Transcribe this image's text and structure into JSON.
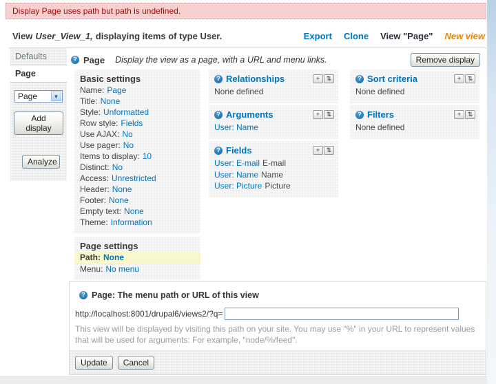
{
  "icons": {
    "question": "?",
    "add": "+",
    "rearrange": "⇅",
    "select_arrow": "▼"
  },
  "colors": {
    "link_blue": "#0074bd",
    "accent_orange": "#f08000",
    "error_red": "#a00c10",
    "error_bg": "#f8cfcf",
    "highlight_yellow": "#fbf7cd"
  },
  "error": {
    "message": "Display Page uses path but path is undefined."
  },
  "header": {
    "view_label": "View",
    "view_name": "User_View_1,",
    "view_desc": "displaying items of type User.",
    "links": {
      "export": "Export",
      "clone": "Clone",
      "view_page": "View \"Page\"",
      "new_view": "New view"
    }
  },
  "sidebar": {
    "tabs": {
      "defaults": "Defaults",
      "page": "Page"
    },
    "display_select_value": "Page",
    "add_display_label": "Add display",
    "analyze_label": "Analyze"
  },
  "display": {
    "title": "Page",
    "description": "Display the view as a page, with a URL and menu links.",
    "remove_label": "Remove display"
  },
  "basic_settings": {
    "title": "Basic settings",
    "rows": [
      {
        "label": "Name:",
        "value": "Page"
      },
      {
        "label": "Title:",
        "value": "None"
      },
      {
        "label": "Style:",
        "value": "Unformatted"
      },
      {
        "label": "Row style:",
        "value": "Fields"
      },
      {
        "label": "Use AJAX:",
        "value": "No"
      },
      {
        "label": "Use pager:",
        "value": "No"
      },
      {
        "label": "Items to display:",
        "value": "10"
      },
      {
        "label": "Distinct:",
        "value": "No"
      },
      {
        "label": "Access:",
        "value": "Unrestricted"
      },
      {
        "label": "Header:",
        "value": "None"
      },
      {
        "label": "Footer:",
        "value": "None"
      },
      {
        "label": "Empty text:",
        "value": "None"
      },
      {
        "label": "Theme:",
        "value": "Information"
      }
    ]
  },
  "page_settings": {
    "title": "Page settings",
    "path_label": "Path:",
    "path_value": "None",
    "menu_label": "Menu:",
    "menu_value": "No menu"
  },
  "panels": {
    "relationships": {
      "title": "Relationships",
      "empty": "None defined"
    },
    "arguments": {
      "title": "Arguments",
      "items": [
        {
          "link": "User: Name"
        }
      ]
    },
    "fields": {
      "title": "Fields",
      "items": [
        {
          "link": "User: E-mail",
          "suffix": "E-mail"
        },
        {
          "link": "User: Name",
          "suffix": "Name"
        },
        {
          "link": "User: Picture",
          "suffix": "Picture"
        }
      ]
    },
    "sort": {
      "title": "Sort criteria",
      "empty": "None defined"
    },
    "filters": {
      "title": "Filters",
      "empty": "None defined"
    }
  },
  "path_form": {
    "title": "Page: The menu path or URL of this view",
    "url_prefix": "http://localhost:8001/drupal6/views2/?q=",
    "input_value": "",
    "description": "This view will be displayed by visiting this path on your site. You may use \"%\" in your URL to represent values that will be used for arguments: For example, \"node/%/feed\".",
    "update_label": "Update",
    "cancel_label": "Cancel"
  }
}
